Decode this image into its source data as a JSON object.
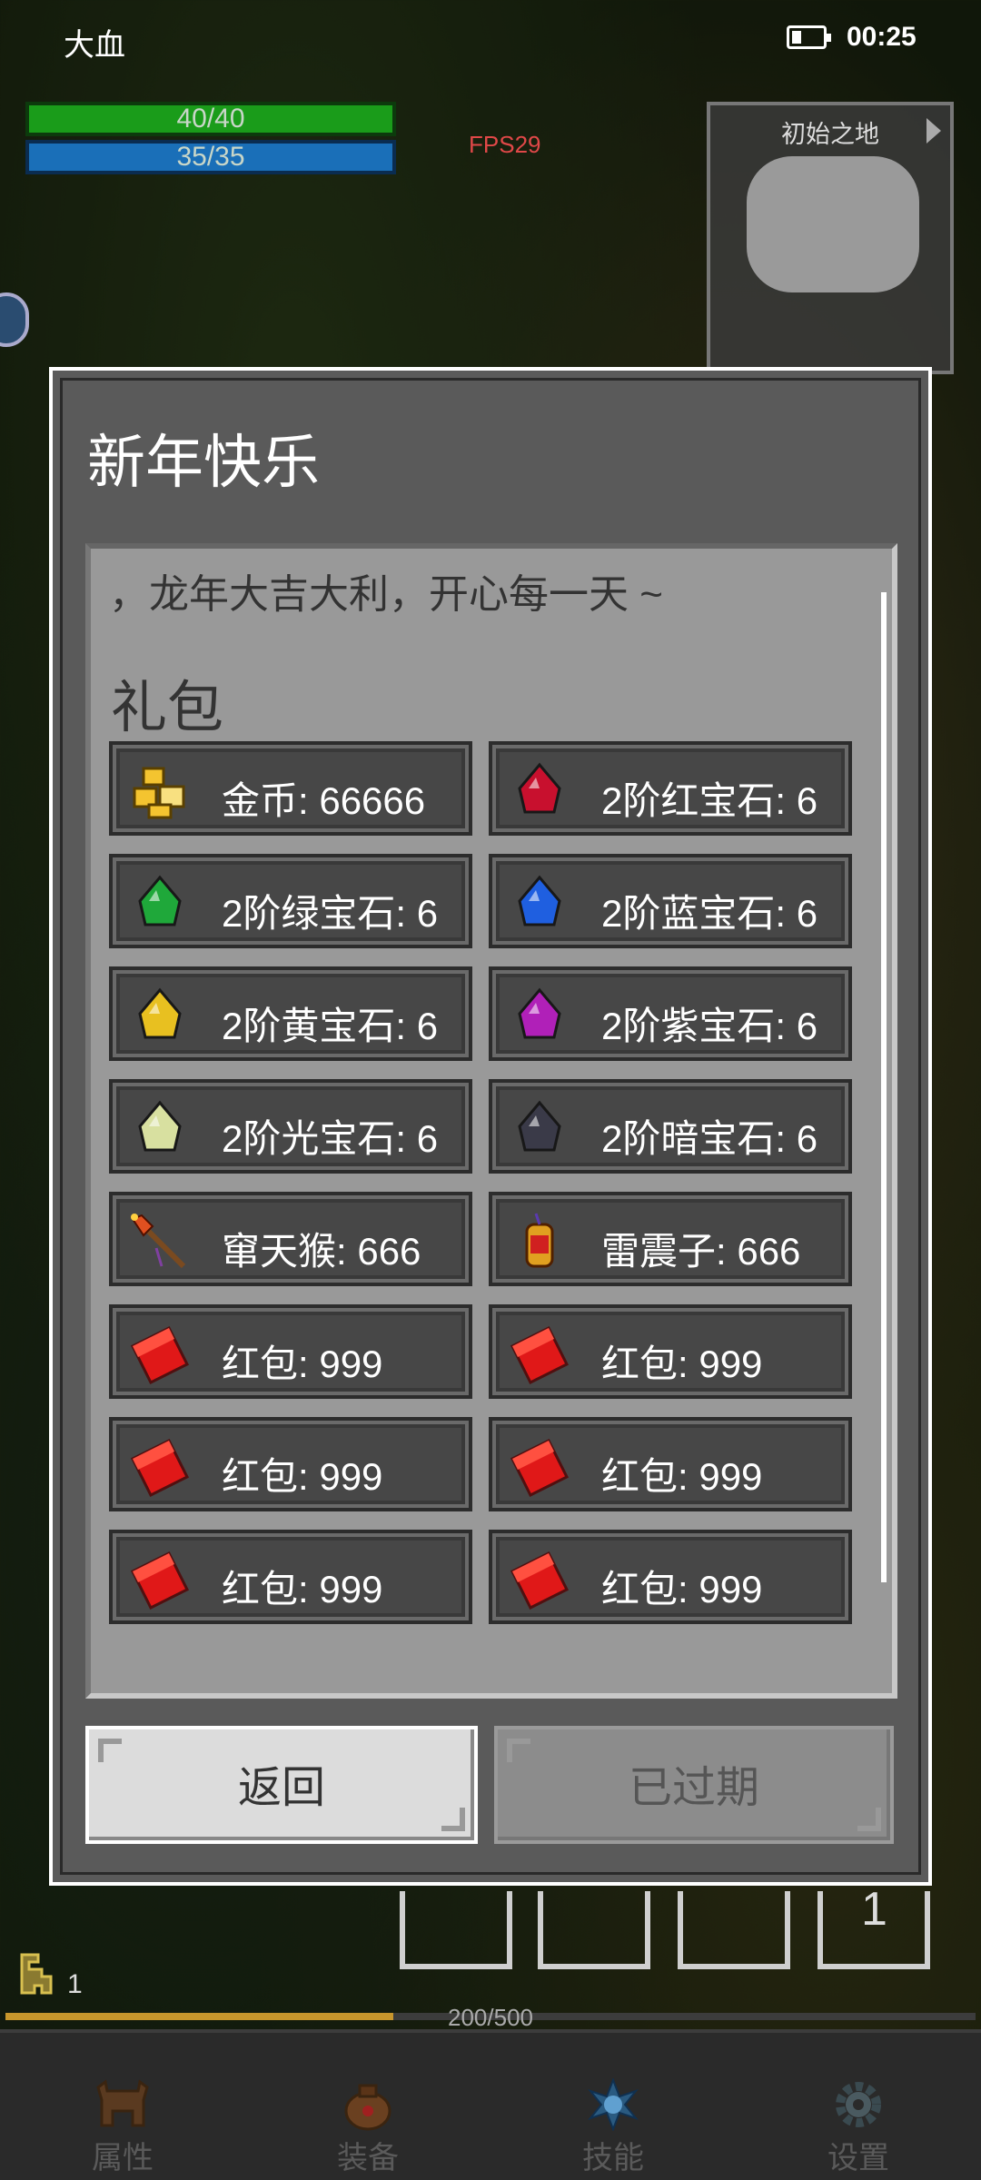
{
  "status_bar": {
    "title": "大血",
    "time": "00:25",
    "battery_level": 0.25
  },
  "hud": {
    "hp": "40/40",
    "mp": "35/35",
    "fps": "FPS29",
    "minimap_title": "初始之地"
  },
  "dialog": {
    "title": "新年快乐",
    "intro_text": "，龙年大吉大利，开心每一天 ~",
    "section_title": "礼包",
    "items": [
      {
        "icon": "gold-coins-icon",
        "label": "金币: 66666",
        "color": "#f4c430"
      },
      {
        "icon": "red-gem-icon",
        "label": "2阶红宝石: 6",
        "color": "#c8102e"
      },
      {
        "icon": "green-gem-icon",
        "label": "2阶绿宝石: 6",
        "color": "#1fa83a"
      },
      {
        "icon": "blue-gem-icon",
        "label": "2阶蓝宝石: 6",
        "color": "#1f5fe0"
      },
      {
        "icon": "yellow-gem-icon",
        "label": "2阶黄宝石: 6",
        "color": "#e8c020"
      },
      {
        "icon": "purple-gem-icon",
        "label": "2阶紫宝石: 6",
        "color": "#b020b8"
      },
      {
        "icon": "light-gem-icon",
        "label": "2阶光宝石: 6",
        "color": "#d8e0a0"
      },
      {
        "icon": "dark-gem-icon",
        "label": "2阶暗宝石: 6",
        "color": "#3a3a48"
      },
      {
        "icon": "firework-rocket-icon",
        "label": "窜天猴: 666",
        "color": "#e05020"
      },
      {
        "icon": "firecracker-icon",
        "label": "雷震子: 666",
        "color": "#e0a020"
      },
      {
        "icon": "red-envelope-icon",
        "label": "红包: 999",
        "color": "#e01818"
      },
      {
        "icon": "red-envelope-icon",
        "label": "红包: 999",
        "color": "#e01818"
      },
      {
        "icon": "red-envelope-icon",
        "label": "红包: 999",
        "color": "#e01818"
      },
      {
        "icon": "red-envelope-icon",
        "label": "红包: 999",
        "color": "#e01818"
      },
      {
        "icon": "red-envelope-icon",
        "label": "红包: 999",
        "color": "#e01818"
      },
      {
        "icon": "red-envelope-icon",
        "label": "红包: 999",
        "color": "#e01818"
      }
    ],
    "back_label": "返回",
    "expired_label": "已过期"
  },
  "bottom": {
    "skill_slot_number": "1",
    "level": "1",
    "xp_text": "200/500",
    "xp_fraction": 0.4,
    "nav": [
      {
        "icon": "helmet-icon",
        "label": "属性"
      },
      {
        "icon": "bag-icon",
        "label": "装备"
      },
      {
        "icon": "skill-orb-icon",
        "label": "技能"
      },
      {
        "icon": "gear-icon",
        "label": "设置"
      }
    ]
  }
}
